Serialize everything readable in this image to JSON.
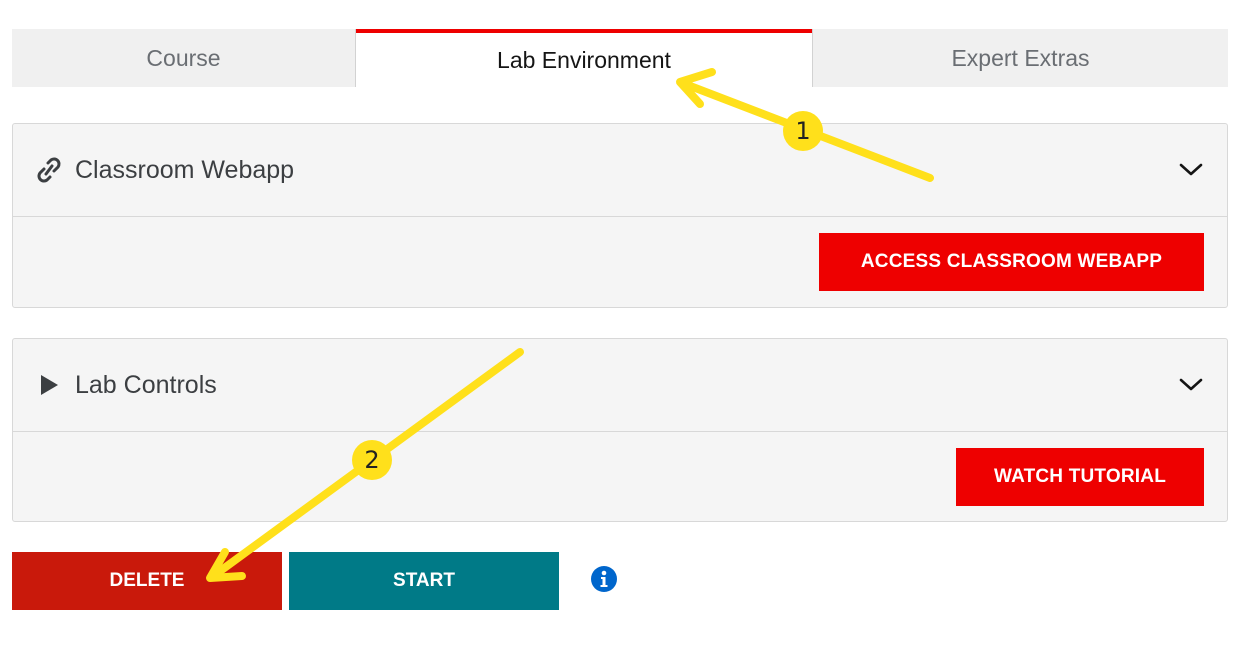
{
  "tabs": [
    {
      "label": "Course",
      "active": false
    },
    {
      "label": "Lab Environment",
      "active": true
    },
    {
      "label": "Expert Extras",
      "active": false
    }
  ],
  "panels": [
    {
      "title": "Classroom Webapp",
      "icon": "link-icon",
      "button": "ACCESS CLASSROOM WEBAPP"
    },
    {
      "title": "Lab Controls",
      "icon": "play-icon",
      "button": "WATCH TUTORIAL"
    }
  ],
  "actions": {
    "delete_label": "DELETE",
    "start_label": "START",
    "info_icon": "info-icon"
  },
  "annotations": {
    "step1": "1",
    "step2": "2",
    "color": "#ffe01b"
  },
  "colors": {
    "accent_red": "#ee0000",
    "delete_red": "#c9190b",
    "start_teal": "#007a87",
    "info_blue": "#0066cc"
  }
}
